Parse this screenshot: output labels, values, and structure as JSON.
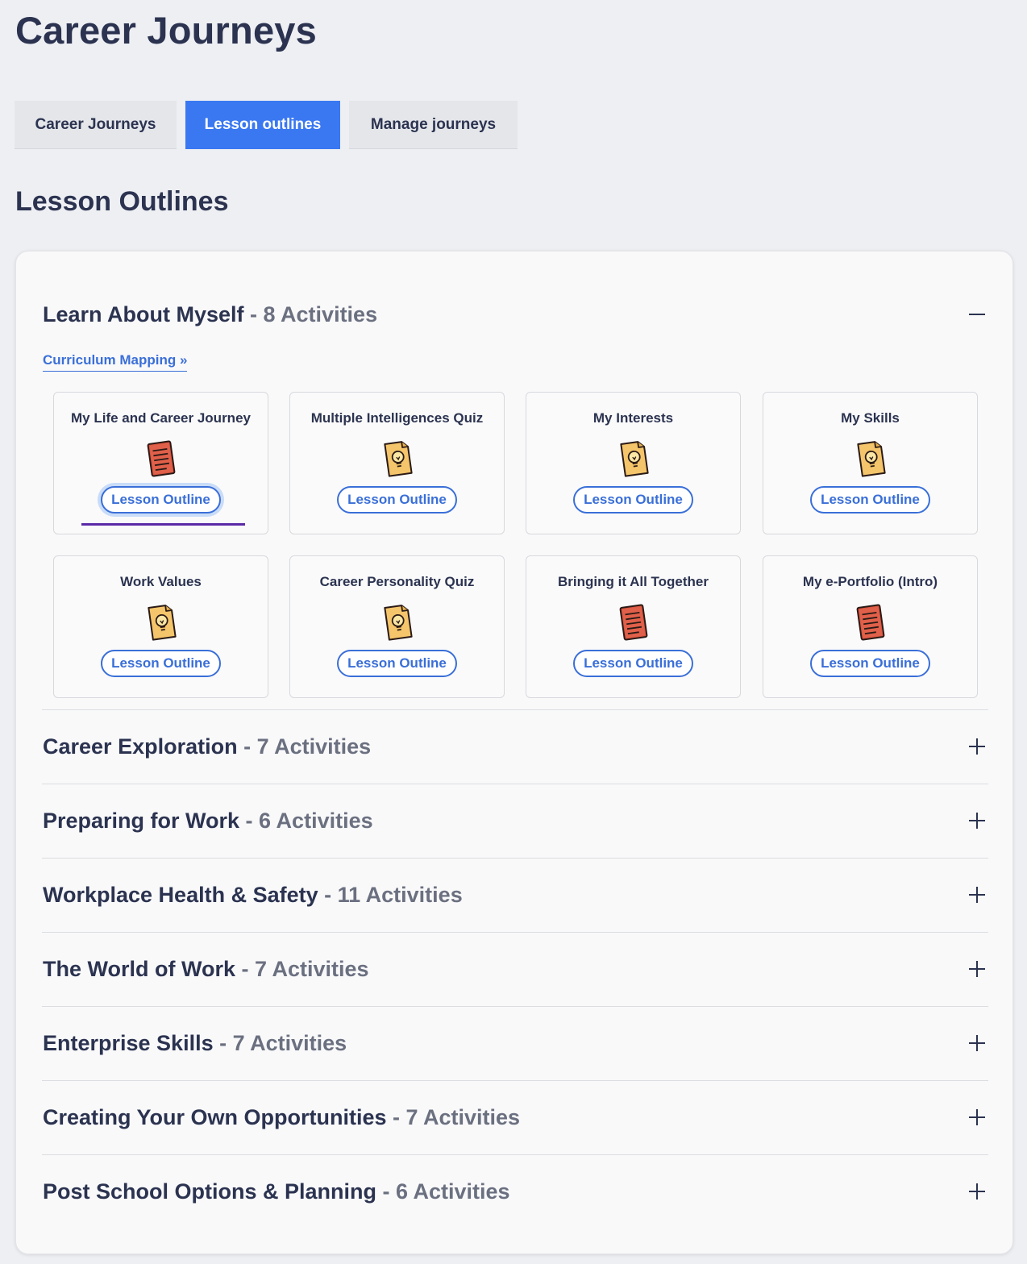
{
  "page": {
    "title": "Career Journeys"
  },
  "tabs": [
    {
      "label": "Career Journeys",
      "active": false
    },
    {
      "label": "Lesson outlines",
      "active": true
    },
    {
      "label": "Manage journeys",
      "active": false
    }
  ],
  "section": {
    "title": "Lesson Outlines"
  },
  "colors": {
    "accent": "#3a78f2",
    "link": "#3a6fd8",
    "text": "#2b3350",
    "muted": "#6b7080"
  },
  "modules": [
    {
      "title": "Learn About Myself",
      "count": " - 8 Activities",
      "expanded": true,
      "curriculum_link": "Curriculum Mapping »",
      "activities": [
        {
          "title": "My Life and Career Journey",
          "icon": "red-notebook-icon",
          "button": "Lesson Outline"
        },
        {
          "title": "Multiple Intelligences Quiz",
          "icon": "lightbulb-document-icon",
          "button": "Lesson Outline"
        },
        {
          "title": "My Interests",
          "icon": "lightbulb-document-icon",
          "button": "Lesson Outline"
        },
        {
          "title": "My Skills",
          "icon": "lightbulb-document-icon",
          "button": "Lesson Outline"
        },
        {
          "title": "Work Values",
          "icon": "lightbulb-document-icon",
          "button": "Lesson Outline"
        },
        {
          "title": "Career Personality Quiz",
          "icon": "lightbulb-document-icon",
          "button": "Lesson Outline"
        },
        {
          "title": "Bringing it All Together",
          "icon": "red-notebook-icon",
          "button": "Lesson Outline"
        },
        {
          "title": "My e-Portfolio (Intro)",
          "icon": "red-notebook-icon",
          "button": "Lesson Outline"
        }
      ]
    },
    {
      "title": "Career Exploration",
      "count": " - 7 Activities",
      "expanded": false
    },
    {
      "title": "Preparing for Work",
      "count": " - 6 Activities",
      "expanded": false
    },
    {
      "title": "Workplace Health & Safety",
      "count": " - 11 Activities",
      "expanded": false
    },
    {
      "title": "The World of Work",
      "count": " - 7 Activities",
      "expanded": false
    },
    {
      "title": "Enterprise Skills",
      "count": " - 7 Activities",
      "expanded": false
    },
    {
      "title": "Creating Your Own Opportunities",
      "count": " - 7 Activities",
      "expanded": false
    },
    {
      "title": "Post School Options & Planning",
      "count": " - 6 Activities",
      "expanded": false
    }
  ]
}
